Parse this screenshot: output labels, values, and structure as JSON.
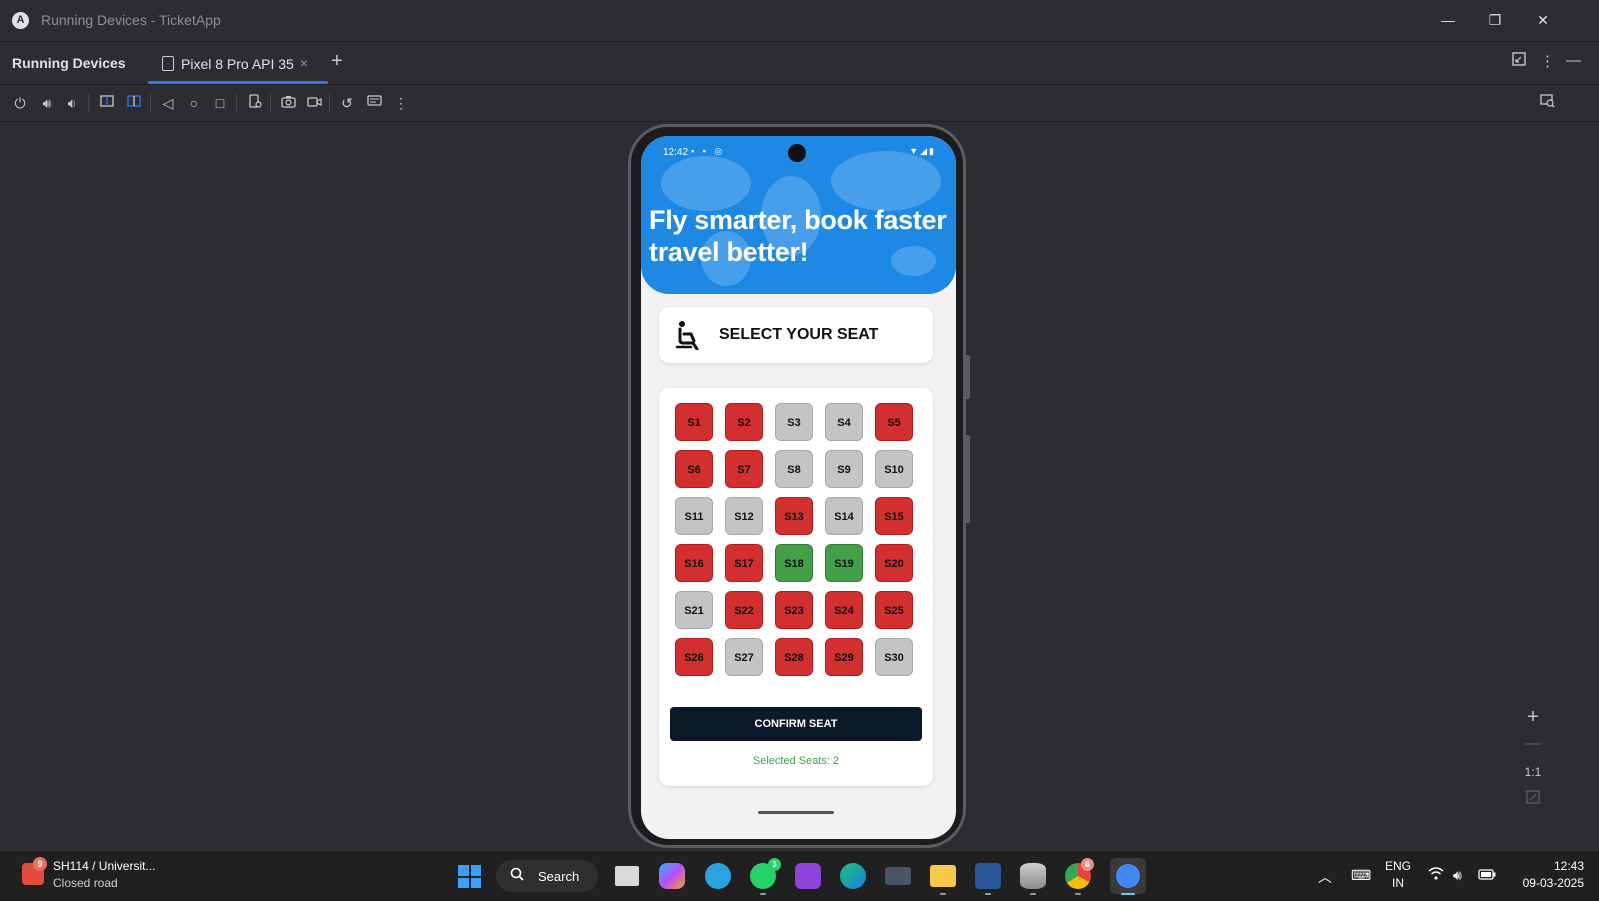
{
  "window": {
    "title": "Running Devices - TicketApp",
    "logo": "A"
  },
  "window_controls": {
    "minimize": "—",
    "restore": "❐",
    "close": "✕"
  },
  "tool_window": {
    "title": "Running Devices",
    "tab_label": "Pixel 8 Pro API 35",
    "tab_close": "×",
    "add_tab": "+"
  },
  "zoom": {
    "in": "+",
    "out": "—",
    "actual": "1:1"
  },
  "phone": {
    "status_time": "12:42",
    "hero_text": "Fly smarter, book faster travel better!",
    "select_title": "SELECT YOUR SEAT",
    "confirm_label": "CONFIRM SEAT",
    "selected_text": "Selected Seats: 2",
    "seats": [
      {
        "label": "S1",
        "state": "booked"
      },
      {
        "label": "S2",
        "state": "booked"
      },
      {
        "label": "S3",
        "state": "available"
      },
      {
        "label": "S4",
        "state": "available"
      },
      {
        "label": "S5",
        "state": "booked"
      },
      {
        "label": "S6",
        "state": "booked"
      },
      {
        "label": "S7",
        "state": "booked"
      },
      {
        "label": "S8",
        "state": "available"
      },
      {
        "label": "S9",
        "state": "available"
      },
      {
        "label": "S10",
        "state": "available"
      },
      {
        "label": "S11",
        "state": "available"
      },
      {
        "label": "S12",
        "state": "available"
      },
      {
        "label": "S13",
        "state": "booked"
      },
      {
        "label": "S14",
        "state": "available"
      },
      {
        "label": "S15",
        "state": "booked"
      },
      {
        "label": "S16",
        "state": "booked"
      },
      {
        "label": "S17",
        "state": "booked"
      },
      {
        "label": "S18",
        "state": "selected"
      },
      {
        "label": "S19",
        "state": "selected"
      },
      {
        "label": "S20",
        "state": "booked"
      },
      {
        "label": "S21",
        "state": "available"
      },
      {
        "label": "S22",
        "state": "booked"
      },
      {
        "label": "S23",
        "state": "booked"
      },
      {
        "label": "S24",
        "state": "booked"
      },
      {
        "label": "S25",
        "state": "booked"
      },
      {
        "label": "S26",
        "state": "booked"
      },
      {
        "label": "S27",
        "state": "available"
      },
      {
        "label": "S28",
        "state": "booked"
      },
      {
        "label": "S29",
        "state": "booked"
      },
      {
        "label": "S30",
        "state": "available"
      }
    ],
    "colors": {
      "booked": "#d32f2f",
      "available": "#c4c4c4",
      "selected": "#43a047",
      "hero": "#1e88e5"
    }
  },
  "taskbar": {
    "weather_title": "SH114 / Universit...",
    "weather_sub": "Closed road",
    "weather_badge": "9",
    "search_label": "Search",
    "whatsapp_badge": "3",
    "chrome_badge": "8",
    "lang_top": "ENG",
    "lang_bottom": "IN",
    "time": "12:43",
    "date": "09-03-2025"
  }
}
